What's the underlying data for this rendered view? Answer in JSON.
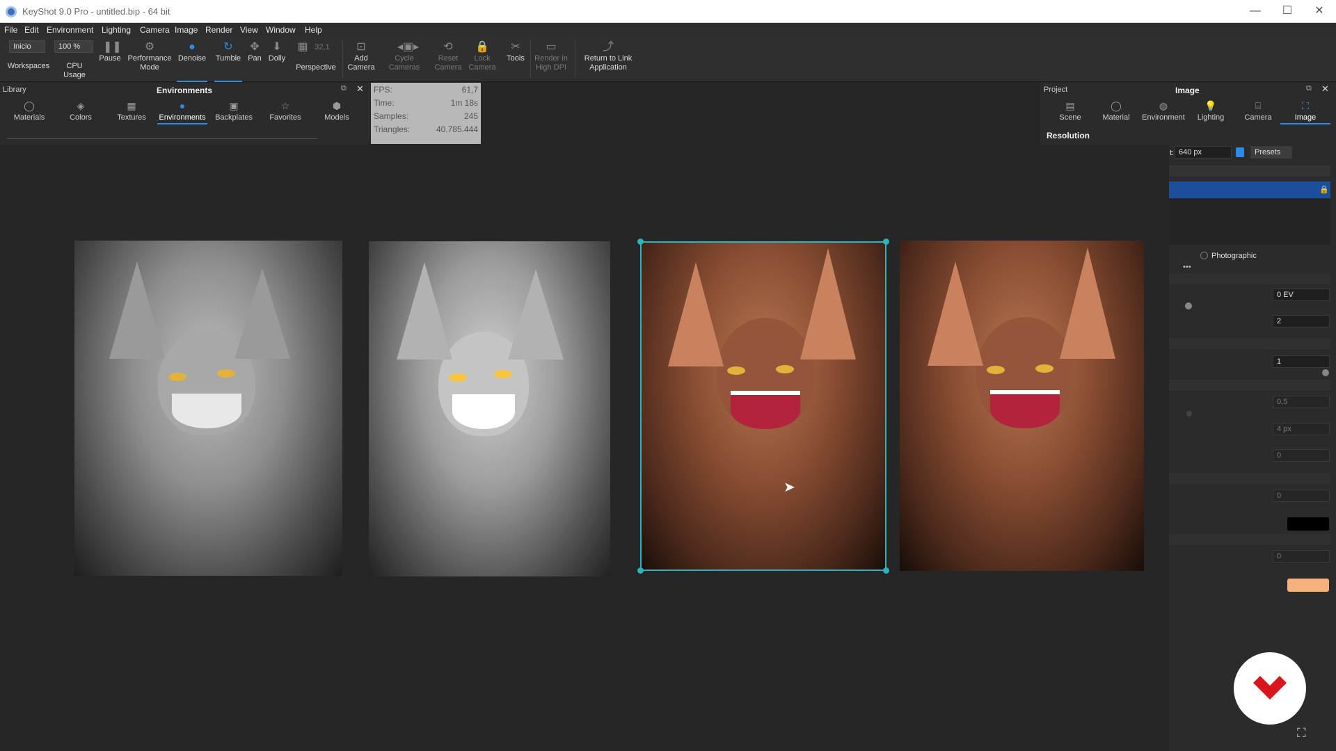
{
  "window": {
    "title": "KeyShot 9.0 Pro  -  untitled.bip  - 64 bit",
    "minimize": "—",
    "maximize": "☐",
    "close": "✕"
  },
  "menu": [
    "File",
    "Edit",
    "Environment",
    "Lighting",
    "Camera",
    "Image",
    "Render",
    "View",
    "Window",
    "Help"
  ],
  "toolbar": {
    "workspace_value": "Inicio",
    "cpu_value": "100 %",
    "frame_value": "32,1",
    "items": {
      "workspaces": "Workspaces",
      "cpu_usage": "CPU Usage",
      "pause": "Pause",
      "performance_mode": "Performance Mode",
      "denoise": "Denoise",
      "tumble": "Tumble",
      "pan": "Pan",
      "dolly": "Dolly",
      "perspective": "Perspective",
      "add_camera": "Add Camera",
      "cycle_cameras": "Cycle Cameras",
      "reset_camera": "Reset Camera",
      "lock_camera": "Lock Camera",
      "tools": "Tools",
      "render_high_dpi": "Render in High DPI",
      "return_link": "Return to Link Application"
    }
  },
  "library": {
    "label": "Library",
    "title": "Environments",
    "tabs": [
      "Materials",
      "Colors",
      "Textures",
      "Environments",
      "Backplates",
      "Favorites",
      "Models"
    ],
    "active_tab": "Environments"
  },
  "stats": [
    {
      "label": "FPS:",
      "value": "61,7"
    },
    {
      "label": "Time:",
      "value": "1m 18s"
    },
    {
      "label": "Samples:",
      "value": "245"
    },
    {
      "label": "Triangles:",
      "value": "40.785.444"
    }
  ],
  "project": {
    "label": "Project",
    "title": "Image",
    "tabs": [
      "Scene",
      "Material",
      "Environment",
      "Lighting",
      "Camera",
      "Image"
    ],
    "active_tab": "Image",
    "section": "Resolution",
    "width_value": "640 px",
    "width_prefix": "t:",
    "presets": "Presets",
    "photographic": "Photographic",
    "exposure": "0 EV",
    "gamma": "2",
    "value_one": "1",
    "dim_value_a": "0,5",
    "dim_value_b": "4 px",
    "dim_value_c": "0",
    "dim_value_d": "0",
    "dim_value_e": "0",
    "more": "•••"
  },
  "colors": {
    "accent": "#2e8ae6",
    "selection": "#2bb3c0",
    "swatch_black": "#000000",
    "swatch_orange": "#f5b27a",
    "logo_red": "#d9141b"
  }
}
